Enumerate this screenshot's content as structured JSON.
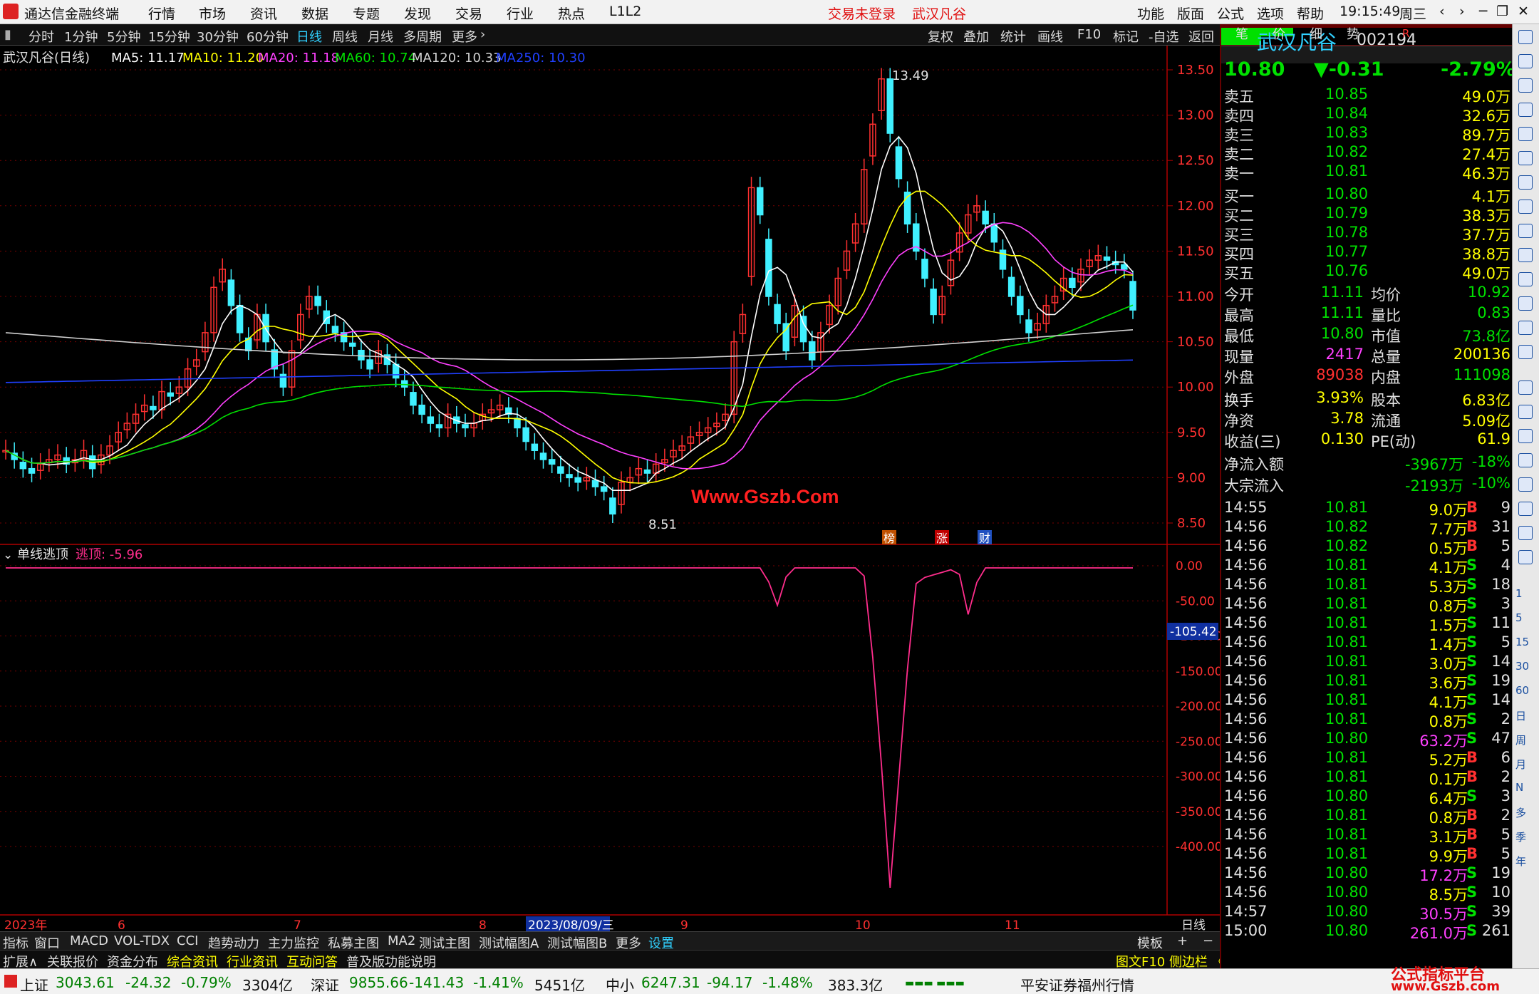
{
  "titlebar": {
    "app_title": "通达信金融终端",
    "menus": [
      "行情",
      "市场",
      "资讯",
      "数据",
      "专题",
      "发现",
      "交易",
      "行业",
      "热点",
      "L1L2"
    ],
    "trade_status": "交易未登录",
    "stock_name": "武汉凡谷",
    "right_menus": [
      "功能",
      "版面",
      "公式",
      "选项",
      "帮助"
    ],
    "clock": "19:15:49",
    "weekday": "周三"
  },
  "toolbar": {
    "periods": [
      "分时",
      "1分钟",
      "5分钟",
      "15分钟",
      "30分钟",
      "60分钟",
      "日线",
      "周线",
      "月线",
      "多周期",
      "更多"
    ],
    "active_period": "日线",
    "actions": [
      "复权",
      "叠加",
      "统计",
      "画线",
      "F10",
      "标记",
      "-自选",
      "返回"
    ]
  },
  "main_chart": {
    "legend_title": "武汉凡谷(日线)",
    "ma_legend": [
      {
        "label": "MA5: 11.17",
        "color": "#ffffff"
      },
      {
        "label": "MA10: 11.20",
        "color": "#ffff00"
      },
      {
        "label": "MA20: 11.18",
        "color": "#ff40ff"
      },
      {
        "label": "MA60: 10.74",
        "color": "#00e000"
      },
      {
        "label": "MA120: 10.33",
        "color": "#d0d0d0"
      },
      {
        "label": "MA250: 10.30",
        "color": "#2040ff"
      }
    ],
    "high_marker": "13.49",
    "low_marker": "8.51",
    "watermark": "Www.Gszb.Com",
    "event_badges": [
      "榜",
      "涨",
      "财"
    ],
    "price_axis": [
      "13.50",
      "13.00",
      "12.50",
      "12.00",
      "11.50",
      "11.00",
      "10.50",
      "10.00",
      "9.50",
      "9.00",
      "8.50"
    ],
    "colors": {
      "up": "#ff3030",
      "down": "#40f0ff",
      "grid": "#8b0000"
    }
  },
  "indicator": {
    "name": "单线逃顶",
    "value_label": "逃顶: -5.96",
    "axis": [
      "0.00",
      "-50.00",
      "-100.00",
      "-150.00",
      "-200.00",
      "-250.00",
      "-300.00",
      "-350.00",
      "-400.00"
    ],
    "current_tag": "-105.42",
    "color": "#ff2d8c"
  },
  "date_axis": {
    "labels": [
      "2023年",
      "6",
      "7",
      "8",
      "2023/08/09/三",
      "9",
      "10",
      "11"
    ],
    "period_label": "日线"
  },
  "bottom_tabs": {
    "row1": [
      "指标",
      "窗口",
      "MACD",
      "VOL-TDX",
      "CCI",
      "趋势动力",
      "主力监控",
      "私募主图",
      "MA2",
      "测试主图",
      "测试幅图A",
      "测试幅图B",
      "更多",
      "设置"
    ],
    "row1_right": [
      "模板",
      "+",
      "−"
    ],
    "row2": [
      "扩展∧",
      "关联报价",
      "资金分布",
      "综合资讯",
      "行业资讯",
      "互动问答",
      "普及版功能说明"
    ],
    "row2_right": "图文F10 侧边栏 《"
  },
  "status_bar": {
    "indices": [
      {
        "name": "上证",
        "value": "3043.61",
        "change": "-24.32",
        "pct": "-0.79%",
        "amount": "3304亿"
      },
      {
        "name": "深证",
        "value": "9855.66",
        "change": "-141.43",
        "pct": "-1.41%",
        "amount": "5451亿"
      },
      {
        "name": "中小",
        "value": "6247.31",
        "change": "-94.17",
        "pct": "-1.48%",
        "amount": "383.3亿"
      }
    ],
    "broker": "平安证券福州行情",
    "corner_title": "公式指标平台",
    "corner_url": "www.Gszb.com"
  },
  "quote": {
    "name": "武汉凡谷",
    "code": "002194",
    "tag": "R",
    "price": "10.80",
    "change": "▼-0.31",
    "pct": "-2.79%",
    "asks": [
      {
        "label": "卖五",
        "price": "10.85",
        "vol": "49.0万"
      },
      {
        "label": "卖四",
        "price": "10.84",
        "vol": "32.6万"
      },
      {
        "label": "卖三",
        "price": "10.83",
        "vol": "89.7万"
      },
      {
        "label": "卖二",
        "price": "10.82",
        "vol": "27.4万"
      },
      {
        "label": "卖一",
        "price": "10.81",
        "vol": "46.3万"
      }
    ],
    "bids": [
      {
        "label": "买一",
        "price": "10.80",
        "vol": "4.1万"
      },
      {
        "label": "买二",
        "price": "10.79",
        "vol": "38.3万"
      },
      {
        "label": "买三",
        "price": "10.78",
        "vol": "37.7万"
      },
      {
        "label": "买四",
        "price": "10.77",
        "vol": "38.8万"
      },
      {
        "label": "买五",
        "price": "10.76",
        "vol": "49.0万"
      }
    ],
    "stats": [
      {
        "l1": "今开",
        "v1": "11.11",
        "l2": "均价",
        "v2": "10.92"
      },
      {
        "l1": "最高",
        "v1": "11.11",
        "l2": "量比",
        "v2": "0.83"
      },
      {
        "l1": "最低",
        "v1": "10.80",
        "l2": "市值",
        "v2": "73.8亿"
      },
      {
        "l1": "现量",
        "v1": "2417",
        "l2": "总量",
        "v2": "200136"
      },
      {
        "l1": "外盘",
        "v1": "89038",
        "l2": "内盘",
        "v2": "111098"
      }
    ],
    "fund": [
      {
        "l1": "换手",
        "v1": "3.93%",
        "l2": "股本",
        "v2": "6.83亿"
      },
      {
        "l1": "净资",
        "v1": "3.78",
        "l2": "流通",
        "v2": "5.09亿"
      },
      {
        "l1": "收益(三)",
        "v1": "0.130",
        "l2": "PE(动)",
        "v2": "61.9"
      }
    ],
    "flows": [
      {
        "label": "净流入额",
        "value": "-3967万",
        "pct": "-18%",
        "bar": 0.18
      },
      {
        "label": "大宗流入",
        "value": "-2193万",
        "pct": "-10%",
        "bar": 0.1
      }
    ]
  },
  "ticks": [
    {
      "time": "14:55",
      "price": "10.81",
      "vol": "9.0万",
      "bs": "B",
      "n": "9"
    },
    {
      "time": "14:56",
      "price": "10.82",
      "vol": "7.7万",
      "bs": "B",
      "n": "31"
    },
    {
      "time": "14:56",
      "price": "10.82",
      "vol": "0.5万",
      "bs": "B",
      "n": "5"
    },
    {
      "time": "14:56",
      "price": "10.81",
      "vol": "4.1万",
      "bs": "S",
      "n": "4"
    },
    {
      "time": "14:56",
      "price": "10.81",
      "vol": "5.3万",
      "bs": "S",
      "n": "18"
    },
    {
      "time": "14:56",
      "price": "10.81",
      "vol": "0.8万",
      "bs": "S",
      "n": "3"
    },
    {
      "time": "14:56",
      "price": "10.81",
      "vol": "1.5万",
      "bs": "S",
      "n": "11"
    },
    {
      "time": "14:56",
      "price": "10.81",
      "vol": "1.4万",
      "bs": "S",
      "n": "5"
    },
    {
      "time": "14:56",
      "price": "10.81",
      "vol": "3.0万",
      "bs": "S",
      "n": "14"
    },
    {
      "time": "14:56",
      "price": "10.81",
      "vol": "3.6万",
      "bs": "S",
      "n": "19"
    },
    {
      "time": "14:56",
      "price": "10.81",
      "vol": "4.1万",
      "bs": "S",
      "n": "14"
    },
    {
      "time": "14:56",
      "price": "10.81",
      "vol": "0.8万",
      "bs": "S",
      "n": "2"
    },
    {
      "time": "14:56",
      "price": "10.80",
      "vol": "63.2万",
      "bs": "S",
      "n": "47"
    },
    {
      "time": "14:56",
      "price": "10.81",
      "vol": "5.2万",
      "bs": "B",
      "n": "6"
    },
    {
      "time": "14:56",
      "price": "10.81",
      "vol": "0.1万",
      "bs": "B",
      "n": "2"
    },
    {
      "time": "14:56",
      "price": "10.80",
      "vol": "6.4万",
      "bs": "S",
      "n": "3"
    },
    {
      "time": "14:56",
      "price": "10.81",
      "vol": "0.8万",
      "bs": "B",
      "n": "2"
    },
    {
      "time": "14:56",
      "price": "10.81",
      "vol": "3.1万",
      "bs": "B",
      "n": "5"
    },
    {
      "time": "14:56",
      "price": "10.81",
      "vol": "9.9万",
      "bs": "B",
      "n": "5"
    },
    {
      "time": "14:56",
      "price": "10.80",
      "vol": "17.2万",
      "bs": "S",
      "n": "19"
    },
    {
      "time": "14:56",
      "price": "10.80",
      "vol": "8.5万",
      "bs": "S",
      "n": "10"
    },
    {
      "time": "14:57",
      "price": "10.80",
      "vol": "30.5万",
      "bs": "S",
      "n": "39"
    },
    {
      "time": "15:00",
      "price": "10.80",
      "vol": "261.0万",
      "bs": "S",
      "n": "261"
    }
  ],
  "right_tabs": [
    "笔",
    "价",
    "细",
    "势"
  ],
  "sidebar_labels": [
    "1",
    "5",
    "15",
    "30",
    "60",
    "日",
    "周",
    "月",
    "N",
    "多",
    "季",
    "年"
  ]
}
